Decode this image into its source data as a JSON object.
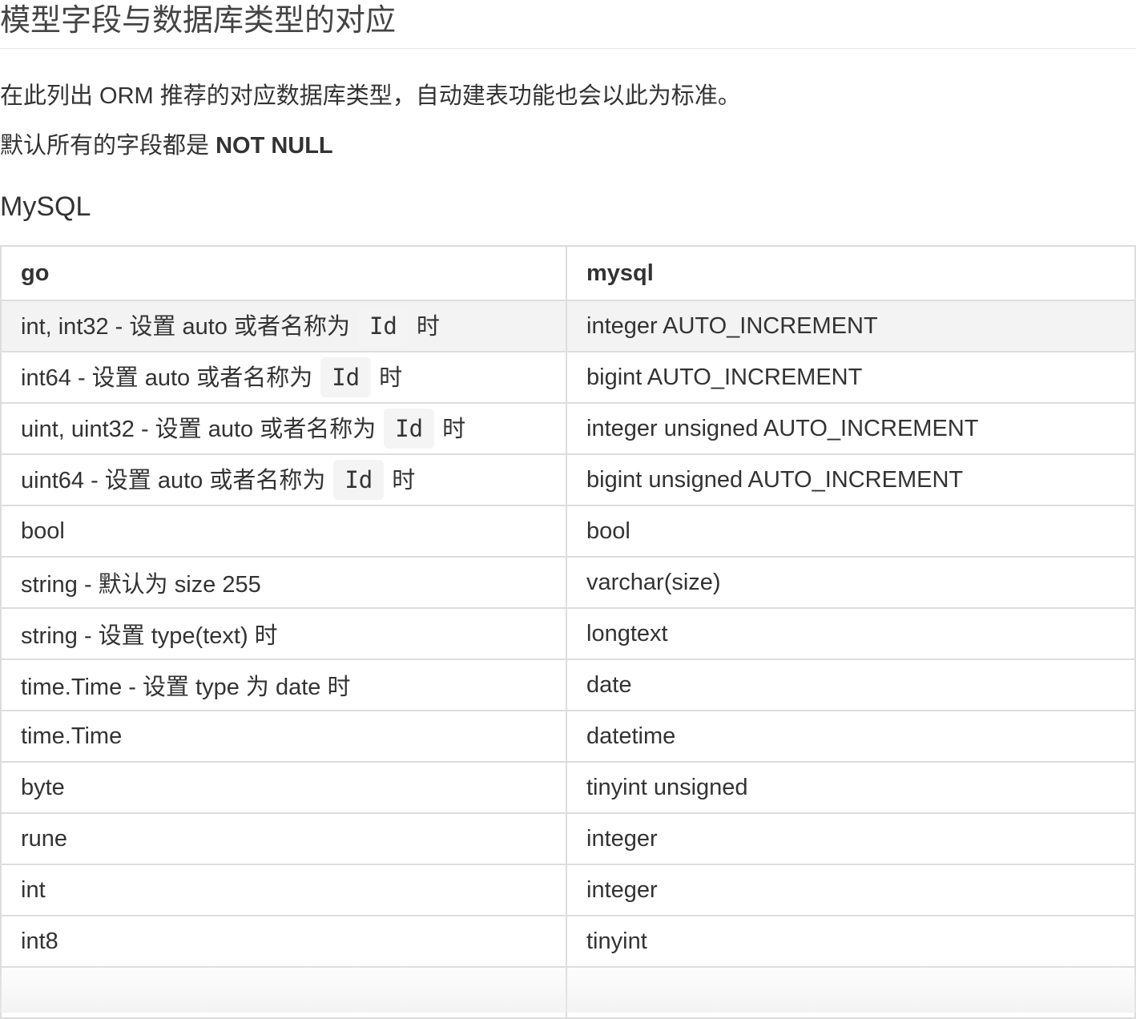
{
  "page": {
    "title": "模型字段与数据库类型的对应",
    "intro": "在此列出 ORM 推荐的对应数据库类型，自动建表功能也会以此为标准。",
    "default_prefix": "默认所有的字段都是 ",
    "default_strong": "NOT NULL",
    "section_heading": "MySQL"
  },
  "table": {
    "headers": [
      "go",
      "mysql"
    ],
    "rows": [
      {
        "go_pre": "int, int32 - 设置 auto 或者名称为",
        "go_code": "Id",
        "go_post": "时",
        "mysql": "integer AUTO_INCREMENT"
      },
      {
        "go_pre": "int64 - 设置 auto 或者名称为",
        "go_code": "Id",
        "go_post": "时",
        "mysql": "bigint AUTO_INCREMENT"
      },
      {
        "go_pre": "uint, uint32 - 设置 auto 或者名称为",
        "go_code": "Id",
        "go_post": "时",
        "mysql": "integer unsigned AUTO_INCREMENT"
      },
      {
        "go_pre": "uint64 - 设置 auto 或者名称为",
        "go_code": "Id",
        "go_post": "时",
        "mysql": "bigint unsigned AUTO_INCREMENT"
      },
      {
        "go": "bool",
        "mysql": "bool"
      },
      {
        "go": "string - 默认为 size 255",
        "mysql": "varchar(size)"
      },
      {
        "go": "string - 设置 type(text) 时",
        "mysql": "longtext"
      },
      {
        "go": "time.Time - 设置 type 为 date 时",
        "mysql": "date"
      },
      {
        "go": "time.Time",
        "mysql": "datetime"
      },
      {
        "go": "byte",
        "mysql": "tinyint unsigned"
      },
      {
        "go": "rune",
        "mysql": "integer"
      },
      {
        "go": "int",
        "mysql": "integer"
      },
      {
        "go": "int8",
        "mysql": "tinyint"
      },
      {
        "go": "",
        "mysql": ""
      }
    ]
  }
}
